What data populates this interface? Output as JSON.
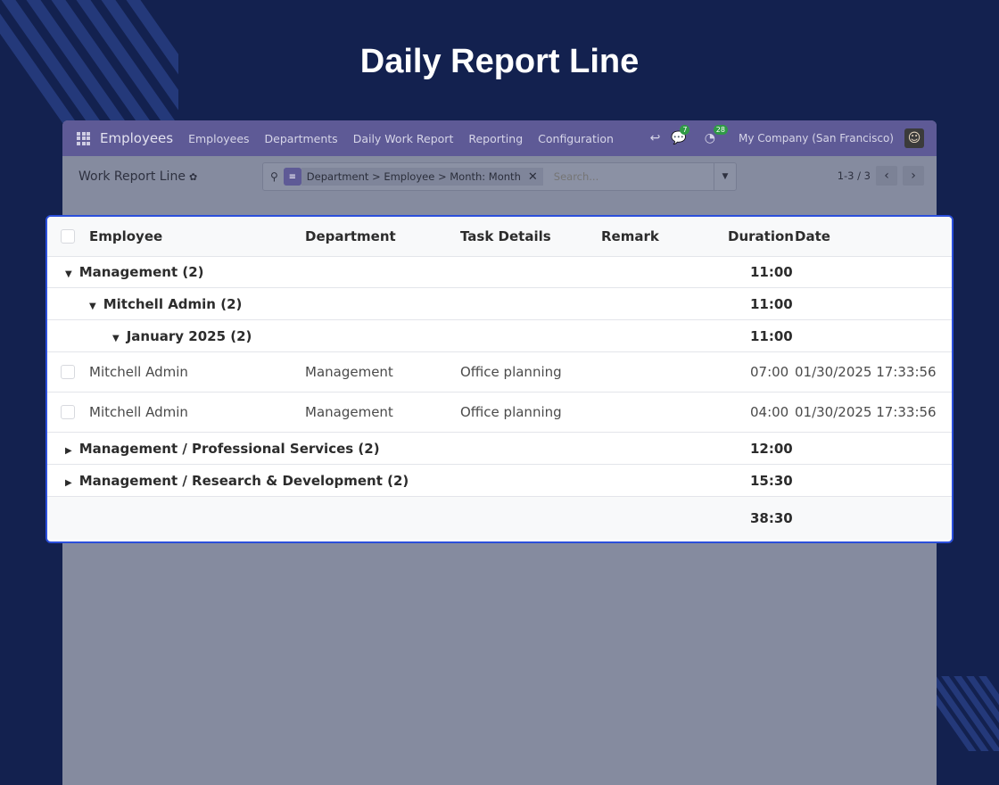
{
  "hero": {
    "title": "Daily Report Line"
  },
  "navbar": {
    "app_name": "Employees",
    "menu": [
      "Employees",
      "Departments",
      "Daily Work Report",
      "Reporting",
      "Configuration"
    ],
    "messages_badge": "7",
    "activities_badge": "28",
    "company": "My Company (San Francisco)"
  },
  "control": {
    "breadcrumb": "Work Report Line",
    "facet": "Department > Employee > Month: Month",
    "search_placeholder": "Search...",
    "pager": "1-3 / 3"
  },
  "table": {
    "headers": {
      "employee": "Employee",
      "department": "Department",
      "task": "Task Details",
      "remark": "Remark",
      "duration": "Duration",
      "date": "Date"
    },
    "groups": [
      {
        "label": "Management (2)",
        "duration": "11:00"
      },
      {
        "label": "Mitchell Admin (2)",
        "duration": "11:00"
      },
      {
        "label": "January 2025 (2)",
        "duration": "11:00"
      }
    ],
    "records": [
      {
        "employee": "Mitchell Admin",
        "department": "Management",
        "task": "Office planning",
        "remark": "",
        "duration": "07:00",
        "date": "01/30/2025 17:33:56"
      },
      {
        "employee": "Mitchell Admin",
        "department": "Management",
        "task": "Office planning",
        "remark": "",
        "duration": "04:00",
        "date": "01/30/2025 17:33:56"
      }
    ],
    "collapsed_groups": [
      {
        "label": "Management / Professional Services (2)",
        "duration": "12:00"
      },
      {
        "label": "Management / Research & Development (2)",
        "duration": "15:30"
      }
    ],
    "total_duration": "38:30"
  }
}
